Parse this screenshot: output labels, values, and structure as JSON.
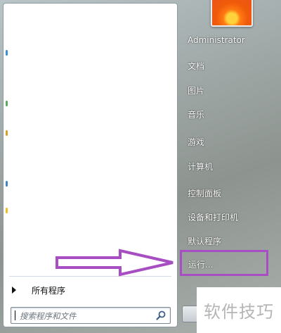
{
  "start_menu": {
    "all_programs_label": "所有程序",
    "search_placeholder": "搜索程序和文件",
    "username": "Administrator",
    "items": [
      {
        "label": "文档"
      },
      {
        "label": "图片"
      },
      {
        "label": "音乐"
      },
      {
        "label": "游戏"
      },
      {
        "label": "计算机"
      },
      {
        "label": "控制面板"
      },
      {
        "label": "设备和打印机"
      },
      {
        "label": "默认程序"
      },
      {
        "label": "运行..."
      }
    ]
  },
  "annotation": {
    "highlight_color": "#a64ec2"
  },
  "watermark": {
    "text": "软件技巧"
  }
}
